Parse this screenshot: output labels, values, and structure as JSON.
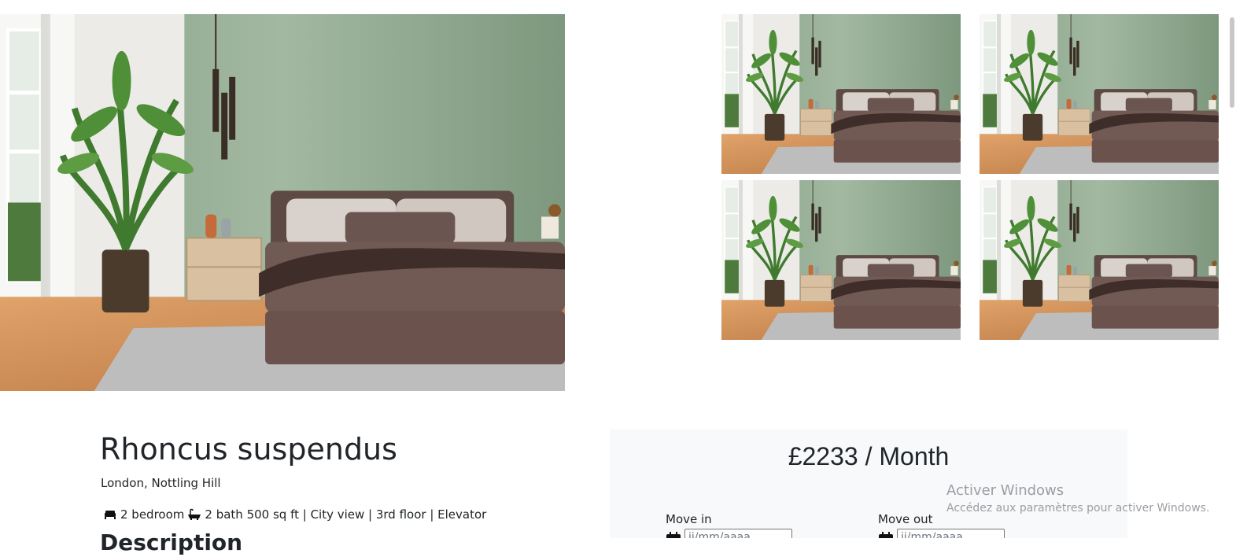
{
  "gallery": {
    "hero_alt": "Bedroom main photo",
    "thumb_alt": "Bedroom photo"
  },
  "listing": {
    "title": "Rhoncus suspendus",
    "location": "London, Nottling Hill",
    "features": [
      {
        "icon": "bed-icon",
        "text": "2 bedroom"
      },
      {
        "icon": "bath-icon",
        "text": "2 bath 500 sq ft | City view | 3rd floor | Elevator"
      }
    ],
    "next_heading": "Description"
  },
  "booking": {
    "price": "£2233 / Month",
    "move_in_label": "Move in",
    "move_out_label": "Move out",
    "date_placeholder": "jj/mm/aaaa"
  },
  "watermark": {
    "title": "Activer Windows",
    "subtitle": "Accédez aux paramètres pour activer Windows."
  },
  "colors": {
    "wall_green": "#8fa88f",
    "bed_brown": "#6e5650",
    "floor_wood": "#c98b52",
    "panel_bg": "#f8f9fa"
  }
}
